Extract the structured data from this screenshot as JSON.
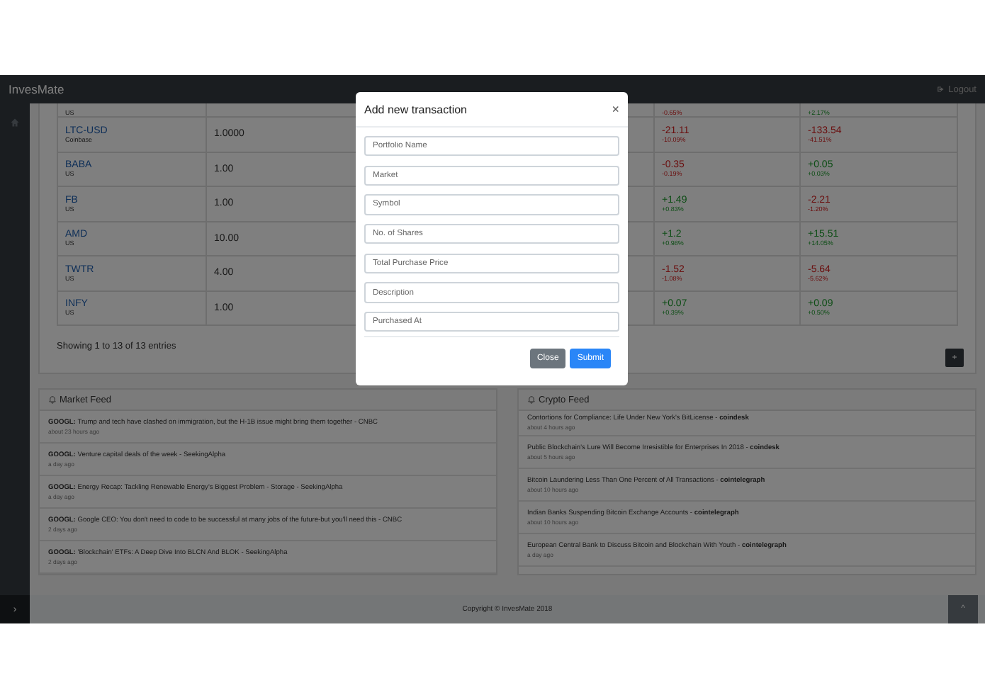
{
  "navbar": {
    "brand": "InvesMate",
    "logout": "Logout"
  },
  "holdings": {
    "rows": [
      {
        "symbol": "",
        "exchange": "US",
        "shares": "",
        "day_change": "",
        "day_pct": "-0.65%",
        "day_up": false,
        "total_change": "",
        "total_pct": "+2.17%",
        "total_up": true
      },
      {
        "symbol": "LTC-USD",
        "exchange": "Coinbase",
        "shares": "1.0000",
        "day_change": "-21.11",
        "day_pct": "-10.09%",
        "day_up": false,
        "total_change": "-133.54",
        "total_pct": "-41.51%",
        "total_up": false
      },
      {
        "symbol": "BABA",
        "exchange": "US",
        "shares": "1.00",
        "day_change": "-0.35",
        "day_pct": "-0.19%",
        "day_up": false,
        "total_change": "+0.05",
        "total_pct": "+0.03%",
        "total_up": true
      },
      {
        "symbol": "FB",
        "exchange": "US",
        "shares": "1.00",
        "day_change": "+1.49",
        "day_pct": "+0.83%",
        "day_up": true,
        "total_change": "-2.21",
        "total_pct": "-1.20%",
        "total_up": false
      },
      {
        "symbol": "AMD",
        "exchange": "US",
        "shares": "10.00",
        "day_change": "+1.2",
        "day_pct": "+0.98%",
        "day_up": true,
        "total_change": "+15.51",
        "total_pct": "+14.05%",
        "total_up": true
      },
      {
        "symbol": "TWTR",
        "exchange": "US",
        "shares": "4.00",
        "day_change": "-1.52",
        "day_pct": "-1.08%",
        "day_up": false,
        "total_change": "-5.64",
        "total_pct": "-5.62%",
        "total_up": false
      },
      {
        "symbol": "INFY",
        "exchange": "US",
        "shares": "1.00",
        "day_change": "+0.07",
        "day_pct": "+0.39%",
        "day_up": true,
        "total_change": "+0.09",
        "total_pct": "+0.50%",
        "total_up": true
      }
    ],
    "info": "Showing 1 to 13 of 13 entries",
    "add_button": "+"
  },
  "market_feed": {
    "title": "Market Feed",
    "items": [
      {
        "ticker": "GOOGL:",
        "headline": "Trump and tech have clashed on immigration, but the H-1B issue might bring them together - CNBC",
        "time": "about 23 hours ago"
      },
      {
        "ticker": "GOOGL:",
        "headline": "Venture capital deals of the week - SeekingAlpha",
        "time": "a day ago"
      },
      {
        "ticker": "GOOGL:",
        "headline": "Energy Recap: Tackling Renewable Energy's Biggest Problem - Storage - SeekingAlpha",
        "time": "a day ago"
      },
      {
        "ticker": "GOOGL:",
        "headline": "Google CEO: You don't need to code to be successful at many jobs of the future-but you'll need this - CNBC",
        "time": "2 days ago"
      },
      {
        "ticker": "GOOGL:",
        "headline": "'Blockchain' ETFs: A Deep Dive Into BLCN And BLOK - SeekingAlpha",
        "time": "2 days ago"
      }
    ]
  },
  "crypto_feed": {
    "title": "Crypto Feed",
    "items": [
      {
        "headline": "Contortions for Compliance: Life Under New York's BitLicense -",
        "source": "coindesk",
        "time": "about 4 hours ago"
      },
      {
        "headline": "Public Blockchain's Lure Will Become Irresistible for Enterprises In 2018 -",
        "source": "coindesk",
        "time": "about 5 hours ago"
      },
      {
        "headline": "Bitcoin Laundering Less Than One Percent of All Transactions -",
        "source": "cointelegraph",
        "time": "about 10 hours ago"
      },
      {
        "headline": "Indian Banks Suspending Bitcoin Exchange Accounts -",
        "source": "cointelegraph",
        "time": "about 10 hours ago"
      },
      {
        "headline": "European Central Bank to Discuss Bitcoin and Blockchain With Youth -",
        "source": "cointelegraph",
        "time": "a day ago"
      }
    ]
  },
  "footer": {
    "copyright": "Copyright © InvesMate 2018",
    "sidebar_toggle": "›",
    "scroll_top": "^"
  },
  "modal": {
    "title": "Add new transaction",
    "close_icon": "×",
    "fields": [
      {
        "placeholder": "Portfolio Name"
      },
      {
        "placeholder": "Market"
      },
      {
        "placeholder": "Symbol"
      },
      {
        "placeholder": "No. of Shares"
      },
      {
        "placeholder": "Total Purchase Price"
      },
      {
        "placeholder": "Description"
      },
      {
        "placeholder": "Purchased At"
      }
    ],
    "buttons": [
      {
        "label": "Close",
        "kind": "secondary"
      },
      {
        "label": "Submit",
        "kind": "primary"
      }
    ]
  }
}
